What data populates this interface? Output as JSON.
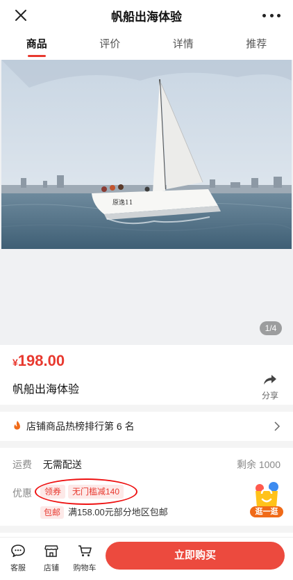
{
  "header": {
    "title": "帆船出海体验",
    "close_icon": "close-icon",
    "more_icon": "more-icon"
  },
  "tabs": [
    {
      "label": "商品",
      "active": true
    },
    {
      "label": "评价"
    },
    {
      "label": "详情"
    },
    {
      "label": "推荐"
    }
  ],
  "gallery": {
    "indicator": "1/4"
  },
  "product": {
    "currency": "¥",
    "price": "198.00",
    "name": "帆船出海体验",
    "share_label": "分享"
  },
  "ranking": {
    "text": "店铺商品热榜排行第 6 名"
  },
  "shipping": {
    "label": "运费",
    "value": "无需配送",
    "stock": "剩余 1000"
  },
  "promo": {
    "label": "优惠",
    "coupons": [
      "领券",
      "无门槛减140"
    ],
    "free_ship_tag": "包邮",
    "free_ship_text": "满158.00元部分地区包邮",
    "stroll_label": "逛一逛"
  },
  "bottom_bar": {
    "service": "客服",
    "store": "店铺",
    "cart": "购物车",
    "buy": "立即购买"
  },
  "colors": {
    "accent": "#e8392f",
    "buy_button": "#ec4a3e"
  }
}
